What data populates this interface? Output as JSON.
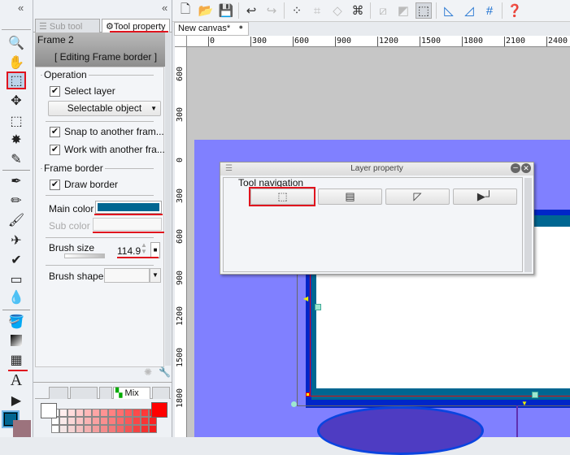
{
  "left_toolbar": {
    "tools": [
      "zoom",
      "move-hand",
      "object",
      "move-layer",
      "selection",
      "auto-select",
      "eyedropper",
      "pen",
      "pencil",
      "brush",
      "airbrush",
      "decoration",
      "eraser",
      "blend",
      "fill",
      "gradient",
      "frame-border",
      "text",
      "ruler"
    ],
    "main_color": "#006691",
    "sub_color": "#9c737d"
  },
  "panel": {
    "tabs": {
      "sub_tool": "Sub tool",
      "tool_property": "Tool property"
    },
    "tool_name": "Frame 2",
    "editing_label": "[ Editing Frame border ]",
    "operation": {
      "title": "Operation",
      "select_layer": "Select layer",
      "select_layer_checked": true,
      "selectable_object": "Selectable object",
      "snap": "Snap to another fram...",
      "snap_checked": true,
      "work_with": "Work with another fra...",
      "work_with_checked": true
    },
    "frame_border": {
      "title": "Frame border",
      "draw_border": "Draw border",
      "draw_border_checked": true,
      "main_color_label": "Main color",
      "main_color": "#006691",
      "sub_color_label": "Sub color",
      "brush_size_label": "Brush size",
      "brush_size": "114.9",
      "brush_shape_label": "Brush shape"
    },
    "color_tab": "Mix"
  },
  "toolbar": {
    "icons": [
      "new",
      "open",
      "save",
      "undo",
      "redo",
      "deselect",
      "transform",
      "clear",
      "crop",
      "hide-ruler",
      "ruler",
      "selection-toggle",
      "perspective",
      "special-ruler",
      "grid",
      "help"
    ]
  },
  "document": {
    "tab": "New canvas*",
    "hruler": [
      "0",
      "300",
      "600",
      "900",
      "1200",
      "1500",
      "1800",
      "2100",
      "2400"
    ],
    "vruler": [
      "600",
      "300",
      "0",
      "300",
      "600",
      "900",
      "1200",
      "1500",
      "1800"
    ]
  },
  "dialog": {
    "title": "Layer property",
    "section": "Tool navigation",
    "buttons": [
      "object",
      "frame-cut",
      "control-point",
      "ruler-frame"
    ]
  }
}
